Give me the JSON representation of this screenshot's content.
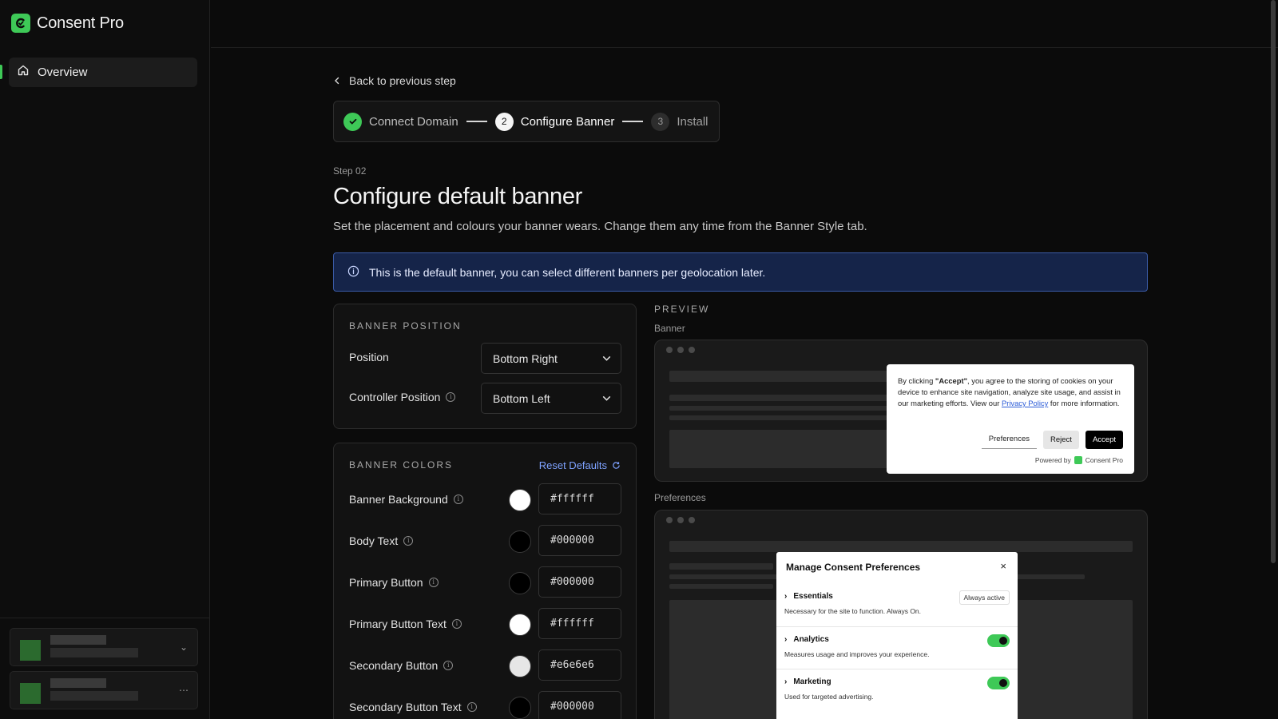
{
  "app": {
    "name": "Consent Pro"
  },
  "sidebar": {
    "items": [
      {
        "label": "Overview",
        "icon": "home-icon",
        "active": true
      }
    ]
  },
  "back": {
    "label": "Back to previous step"
  },
  "stepper": {
    "steps": [
      {
        "number": "1",
        "label": "Connect Domain",
        "state": "done"
      },
      {
        "number": "2",
        "label": "Configure Banner",
        "state": "active"
      },
      {
        "number": "3",
        "label": "Install",
        "state": "todo"
      }
    ]
  },
  "page": {
    "step_tag": "Step 02",
    "title": "Configure default banner",
    "subtitle": "Set the placement and colours your banner wears. Change them any time from the Banner Style tab."
  },
  "info": {
    "text": "This is the default banner, you can select different banners per geolocation later."
  },
  "banner_position": {
    "heading": "BANNER POSITION",
    "position_label": "Position",
    "position_value": "Bottom Right",
    "controller_label": "Controller Position",
    "controller_value": "Bottom Left"
  },
  "banner_colors": {
    "heading": "BANNER COLORS",
    "reset_label": "Reset Defaults",
    "rows": [
      {
        "label": "Banner Background",
        "value": "#ffffff"
      },
      {
        "label": "Body Text",
        "value": "#000000"
      },
      {
        "label": "Primary Button",
        "value": "#000000"
      },
      {
        "label": "Primary Button Text",
        "value": "#ffffff"
      },
      {
        "label": "Secondary Button",
        "value": "#e6e6e6"
      },
      {
        "label": "Secondary Button Text",
        "value": "#000000"
      }
    ]
  },
  "preview": {
    "heading": "PREVIEW",
    "banner_label": "Banner",
    "preferences_label": "Preferences",
    "cookie": {
      "text_before": "By clicking ",
      "accept_quote": "\"Accept\"",
      "text_middle": ", you agree to the storing of cookies on your device to enhance site navigation, analyze site usage, and assist in our marketing efforts. View our ",
      "link": "Privacy Policy",
      "text_after": " for more information.",
      "preferences_btn": "Preferences",
      "reject_btn": "Reject",
      "accept_btn": "Accept",
      "powered_by": "Powered by",
      "powered_brand": "Consent Pro"
    },
    "modal": {
      "title": "Manage Consent Preferences",
      "close": "×",
      "rows": [
        {
          "name": "Essentials",
          "desc": "Necessary for the site to function. Always On.",
          "badge": "Always active",
          "toggle": null
        },
        {
          "name": "Analytics",
          "desc": "Measures usage and improves your experience.",
          "badge": null,
          "toggle": true
        },
        {
          "name": "Marketing",
          "desc": "Used for targeted advertising.",
          "badge": null,
          "toggle": true
        }
      ]
    }
  },
  "colors": {
    "accent": "#3ec957",
    "link": "#7ea2ff",
    "info_bg": "#152449"
  }
}
